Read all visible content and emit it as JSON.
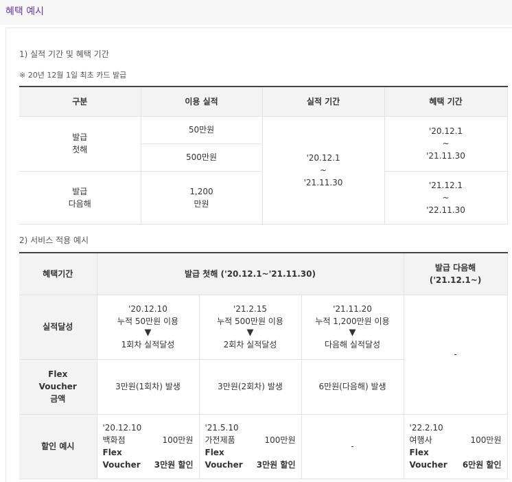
{
  "page_title": "혜택 예시",
  "section1": {
    "title": "1) 실적 기간 및 혜택 기간",
    "note": "※ 20년 12월 1일 최초 카드 발급",
    "headers": [
      "구분",
      "이용 실적",
      "실적 기간",
      "혜택 기간"
    ],
    "group1_lines": [
      "발급",
      "첫해"
    ],
    "usage1": "50만원",
    "usage2": "500만원",
    "period_lines": [
      "'20.12.1",
      "~",
      "'21.11.30"
    ],
    "benefit1_lines": [
      "'20.12.1",
      "~",
      "'21.11.30"
    ],
    "group2_lines": [
      "발급",
      "다음해"
    ],
    "usage3_lines": [
      "1,200",
      "만원"
    ],
    "benefit2_lines": [
      "'21.12.1",
      "~",
      "'22.11.30"
    ]
  },
  "section2": {
    "title": "2) 서비스 적용 예시",
    "header_period": "혜택기간",
    "header_first": "발급 첫해 ('20.12.1~'21.11.30)",
    "header_next_lines": [
      "발급 다음해",
      "('21.12.1~)"
    ],
    "row_achieve": "실적달성",
    "achieve": [
      {
        "date": "'20.12.10",
        "desc": "누적 50만원 이용",
        "arrow": "▼",
        "result": "1회차 실적달성"
      },
      {
        "date": "'21.2.15",
        "desc": "누적 500만원 이용",
        "arrow": "▼",
        "result": "2회차 실적달성"
      },
      {
        "date": "'21.11.20",
        "desc": "누적 1,200만원 이용",
        "arrow": "▼",
        "result": "다음해 실적달성"
      }
    ],
    "next_dash": "-",
    "row_voucher_lines": [
      "Flex",
      "Voucher",
      "금액"
    ],
    "voucher": [
      "3만원(1회차) 발생",
      "3만원(2회차) 발생",
      "6만원(다음해) 발생"
    ],
    "row_discount": "할인 예시",
    "discount": [
      {
        "date": "'20.12.10",
        "shop": "백화점",
        "amount": "100만원",
        "l3": "Flex",
        "l4a": "Voucher",
        "l4b": "3만원 할인"
      },
      {
        "date": "'21.5.10",
        "shop": "가전제품",
        "amount": "100만원",
        "l3": "Flex",
        "l4a": "Voucher",
        "l4b": "3만원 할인"
      }
    ],
    "discount_dash": "-",
    "discount_next": {
      "date": "'22.2.10",
      "shop": "여행사",
      "amount": "100만원",
      "l3": "Flex",
      "l4a": "Voucher",
      "l4b": "6만원 할인"
    }
  }
}
